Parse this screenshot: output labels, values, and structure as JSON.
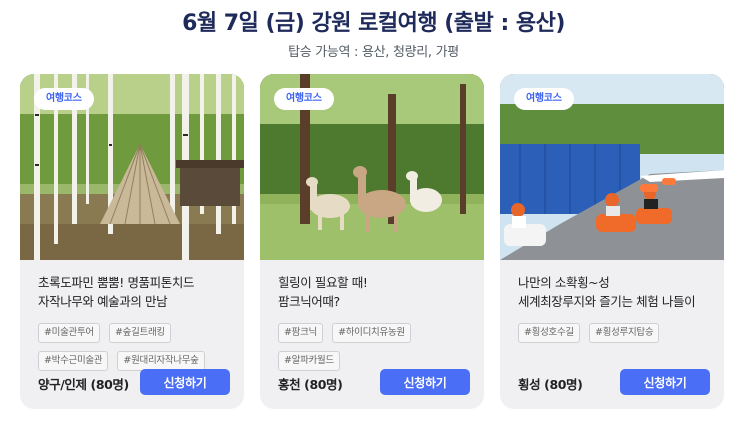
{
  "header": {
    "title": "6월 7일 (금) 강원 로컬여행 (출발 : 용산)",
    "subtitle": "탑승 가능역 :  용산, 청량리, 가평"
  },
  "colors": {
    "title": "#1e2a5a",
    "accent": "#4a6ef5",
    "badge_text": "#3e64f0",
    "card_bg": "#f0f0f2"
  },
  "cards": [
    {
      "badge": "여행코스",
      "image_description": "birch forest with teepee",
      "desc_line1": "초록도파민 뿜뿜! 명품피톤치드",
      "desc_line2": "자작나무와 예술과의 만남",
      "tags": [
        "#미술관투어",
        "#숲길트래킹",
        "#박수근미술관",
        "#원대리자작나무숲"
      ],
      "region": "양구/인제 (80명)",
      "button": "신청하기"
    },
    {
      "badge": "여행코스",
      "image_description": "alpacas grazing in forest",
      "desc_line1": "힐링이 필요할 때!",
      "desc_line2": "팜크닉어때?",
      "tags": [
        "#팜크닉",
        "#하이디치유농원",
        "#알파카월드"
      ],
      "region": "홍천 (80명)",
      "button": "신청하기"
    },
    {
      "badge": "여행코스",
      "image_description": "luge riders on track",
      "desc_line1": "나만의 소확횡~성",
      "desc_line2": "세계최장루지와 즐기는 체험 나들이",
      "tags": [
        "#횡성호수길",
        "#횡성루지탑승"
      ],
      "region": "횡성 (80명)",
      "button": "신청하기"
    }
  ]
}
